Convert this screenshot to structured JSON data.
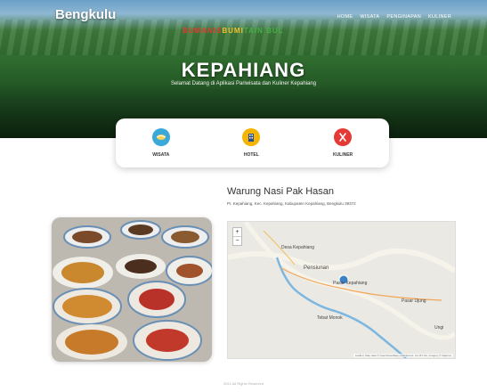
{
  "brand": "Bengkulu",
  "colorful_text": [
    "BUMANIS",
    "BUMI",
    "TAIN BUL"
  ],
  "nav": [
    "HOME",
    "WISATA",
    "PENGINAPAN",
    "KULINER"
  ],
  "hero": {
    "title": "KEPAHIANG",
    "subtitle": "Selamat Datang di Aplikasi Pariwisata dan Kuliner Kepahiang"
  },
  "categories": [
    {
      "label": "WISATA",
      "icon": "globe-icon",
      "color": "#3aa8d8"
    },
    {
      "label": "HOTEL",
      "icon": "hotel-icon",
      "color": "#f4b400"
    },
    {
      "label": "KULINER",
      "icon": "utensils-icon",
      "color": "#e53935"
    }
  ],
  "restaurant": {
    "name": "Warung Nasi Pak Hasan",
    "address": "Pr. Kepahiang, Kec. Kepahiang, Kabupaten Kepahiang, Bengkulu 39372"
  },
  "map": {
    "zoom_in": "+",
    "zoom_out": "−",
    "labels": [
      "Desa Kepahiang",
      "Pensiunan",
      "Pasar Kepahiang",
      "Pasar Ujung",
      "Tebat Monok",
      "Ungi"
    ],
    "attribution": "Leaflet | Map data © OpenStreetMap contributors, CC-BY-SA, Imagery © Mapbox"
  },
  "footer": "2021 All Rights Reserved"
}
